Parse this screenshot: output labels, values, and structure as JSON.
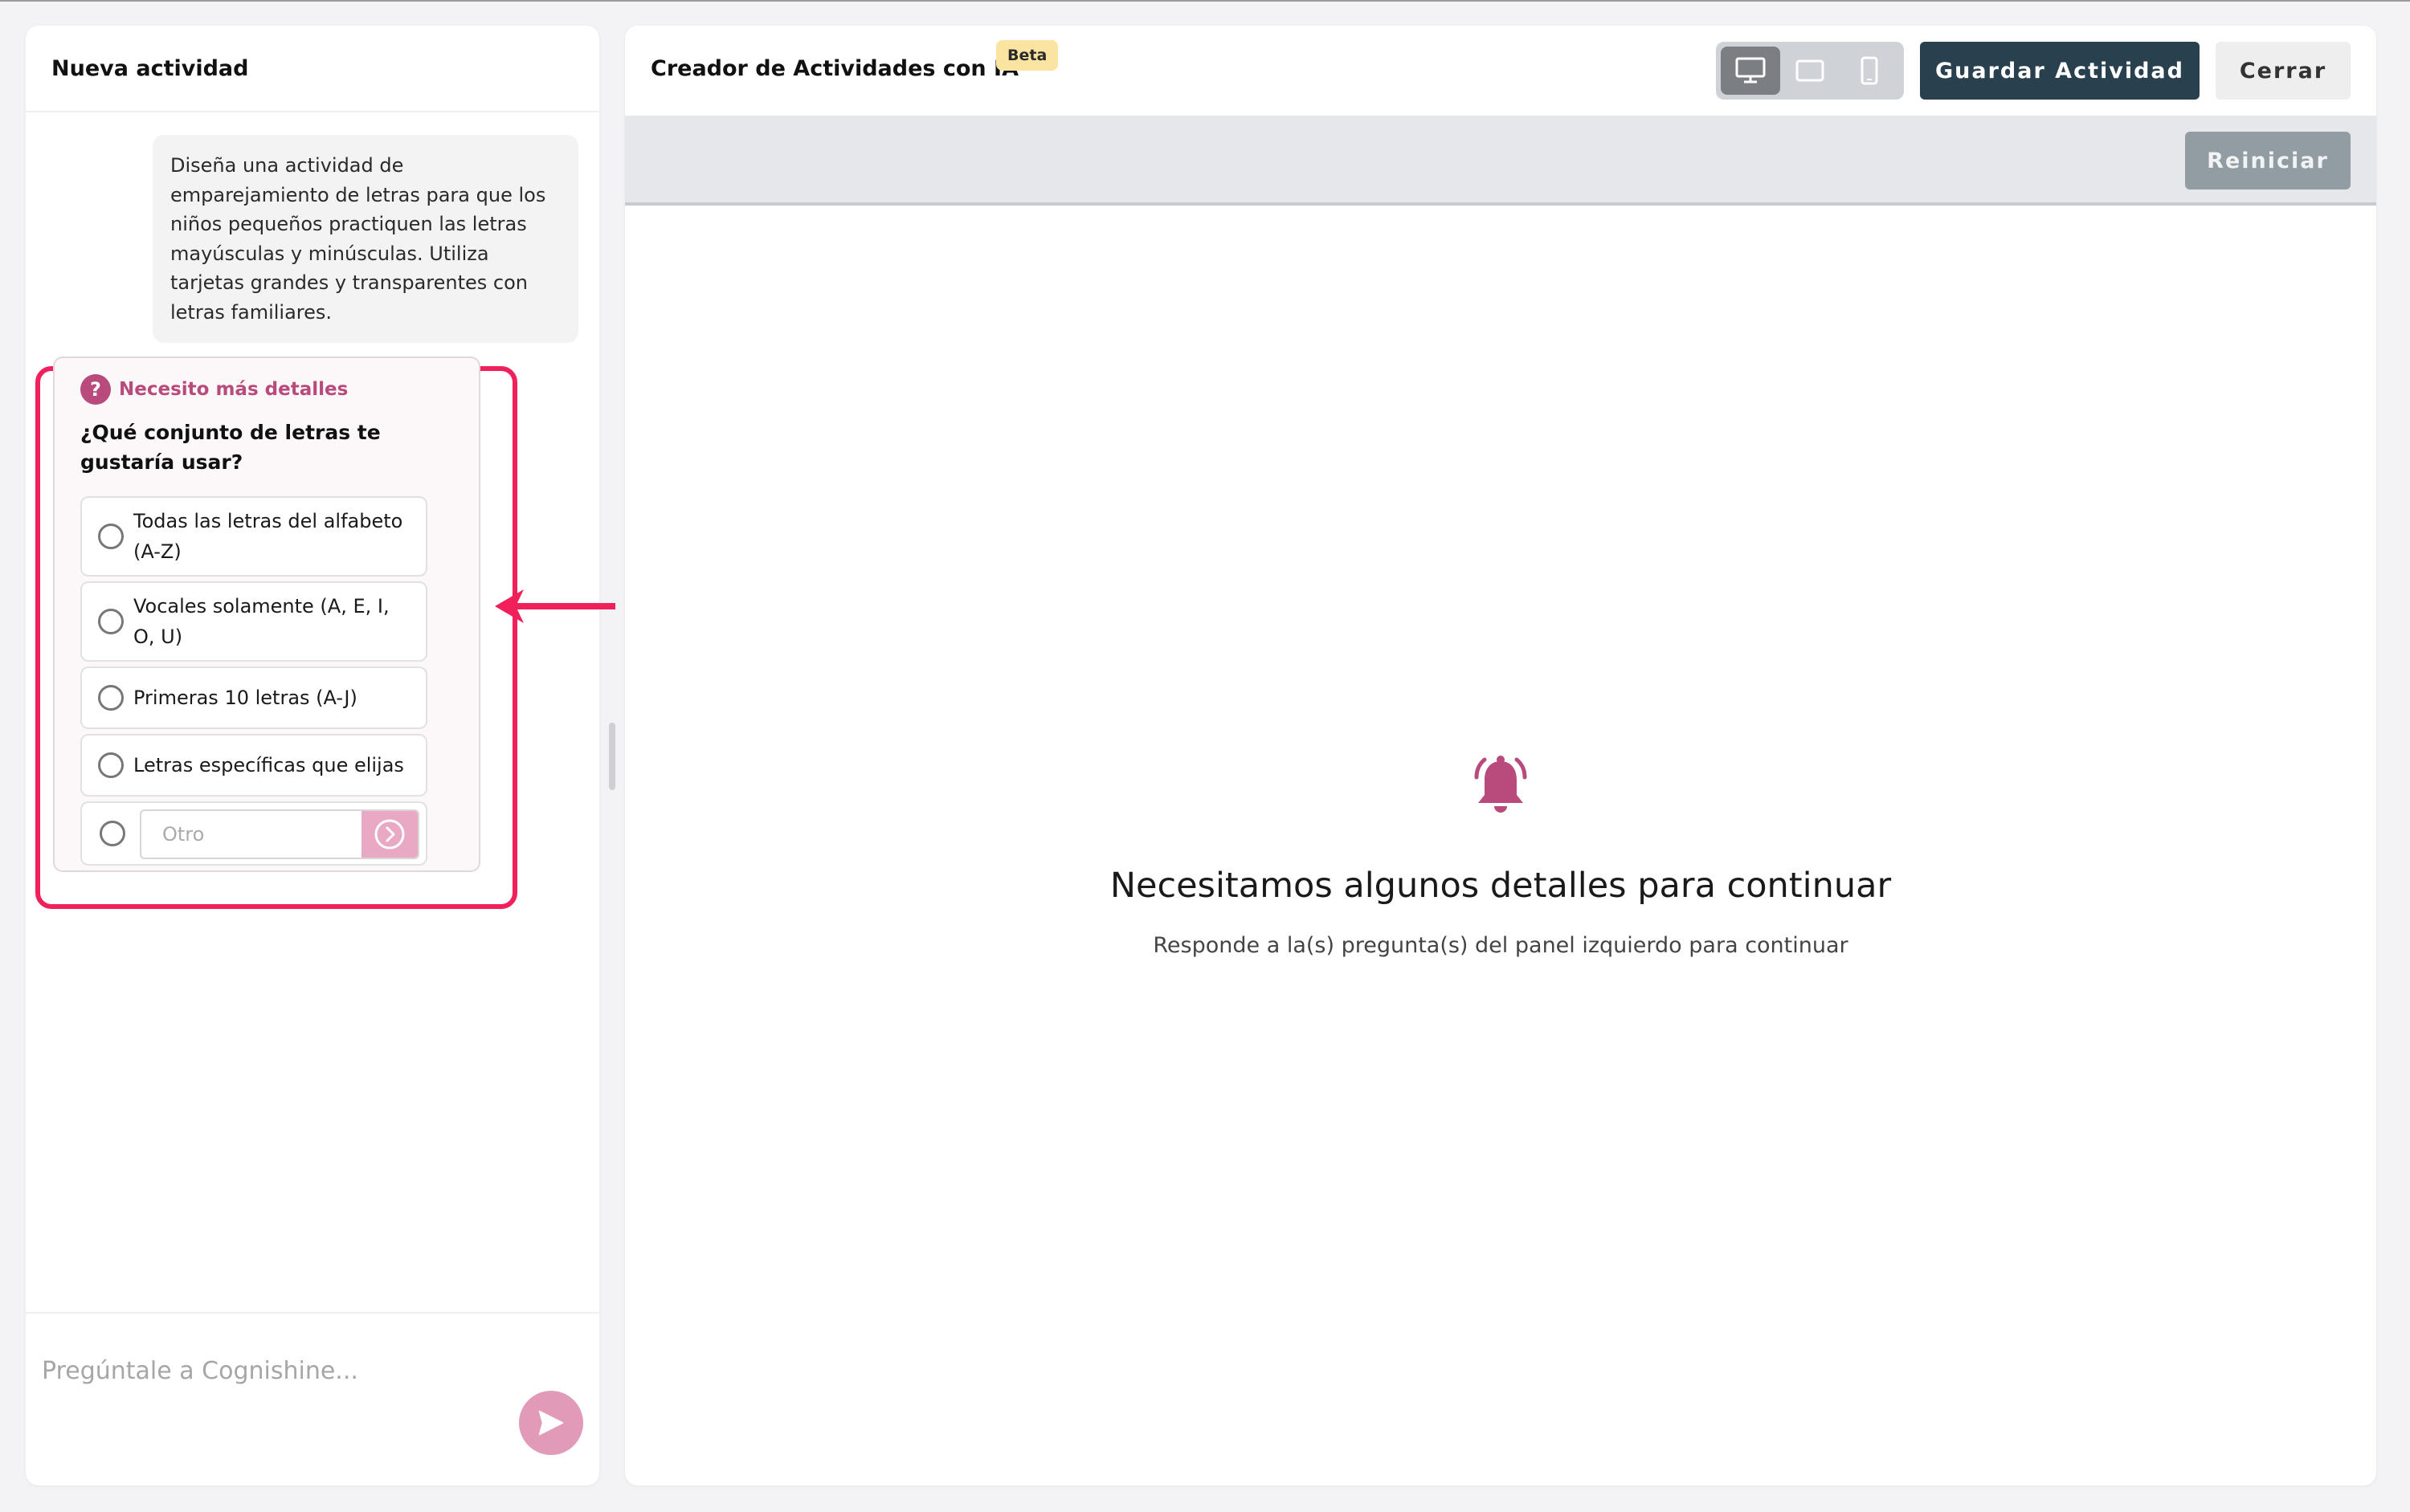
{
  "left": {
    "header_title": "Nueva actividad",
    "user_message": "Diseña una actividad de emparejamiento de letras para que los niños pequeños practiquen las letras mayúsculas y minúsculas. Utiliza tarjetas grandes y transparentes con letras familiares.",
    "question": {
      "badge": "Necesito más detalles",
      "title": "¿Qué conjunto de letras te gustaría usar?",
      "options": [
        "Todas las letras del alfabeto (A-Z)",
        "Vocales solamente (A, E, I, O, U)",
        "Primeras 10 letras (A-J)",
        "Letras específicas que elijas"
      ],
      "other_placeholder": "Otro"
    },
    "chat_placeholder": "Pregúntale a Cognishine..."
  },
  "right": {
    "title": "Creador de Actividades con IA",
    "beta": "Beta",
    "save_label": "Guardar Actividad",
    "close_label": "Cerrar",
    "reset_label": "Reiniciar",
    "empty_title": "Necesitamos algunos detalles para continuar",
    "empty_subtitle": "Responde a la(s) pregunta(s) del panel izquierdo para continuar"
  },
  "colors": {
    "accent": "#b84a7c",
    "highlight": "#f0215a",
    "save_button": "#29404f"
  },
  "icons": [
    "question-icon",
    "send-icon",
    "desktop-icon",
    "tablet-icon",
    "mobile-icon",
    "bell-icon",
    "arrow-left-icon",
    "chevron-right-icon"
  ]
}
